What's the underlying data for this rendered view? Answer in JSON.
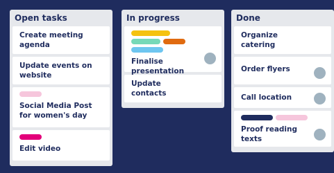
{
  "colors": {
    "background": "#1f2c5e",
    "column": "#e6e8ec",
    "card": "#ffffff",
    "text": "#1f2c5e",
    "avatar": "#9fb2bf",
    "label_pink": "#f6c6dc",
    "label_magenta": "#e3007a",
    "label_yellow": "#f5c20f",
    "label_teal": "#76d9b8",
    "label_orange": "#e06b10",
    "label_blue": "#6ec6f0",
    "label_navy": "#1f2c5e"
  },
  "columns": [
    {
      "title": "Open tasks",
      "cards": [
        {
          "title": "Create meeting agenda"
        },
        {
          "title": "Update events on website"
        },
        {
          "title": "Social Media Post for women's day",
          "labels": [
            "pink"
          ]
        },
        {
          "title": "Edit video",
          "labels": [
            "magenta"
          ]
        }
      ]
    },
    {
      "title": "In progress",
      "cards": [
        {
          "title": "Finalise presentation",
          "labels": [
            "yellow",
            "teal",
            "orange",
            "blue"
          ],
          "avatar": "user-avatar"
        },
        {
          "title": "Update contacts"
        }
      ]
    },
    {
      "title": "Done",
      "cards": [
        {
          "title": "Organize catering"
        },
        {
          "title": "Order flyers",
          "avatar": "user-avatar"
        },
        {
          "title": "Call location",
          "avatar": "user-avatar"
        },
        {
          "title": "Proof reading texts",
          "labels": [
            "navy",
            "pink"
          ],
          "avatar": "user-avatar"
        }
      ]
    }
  ]
}
